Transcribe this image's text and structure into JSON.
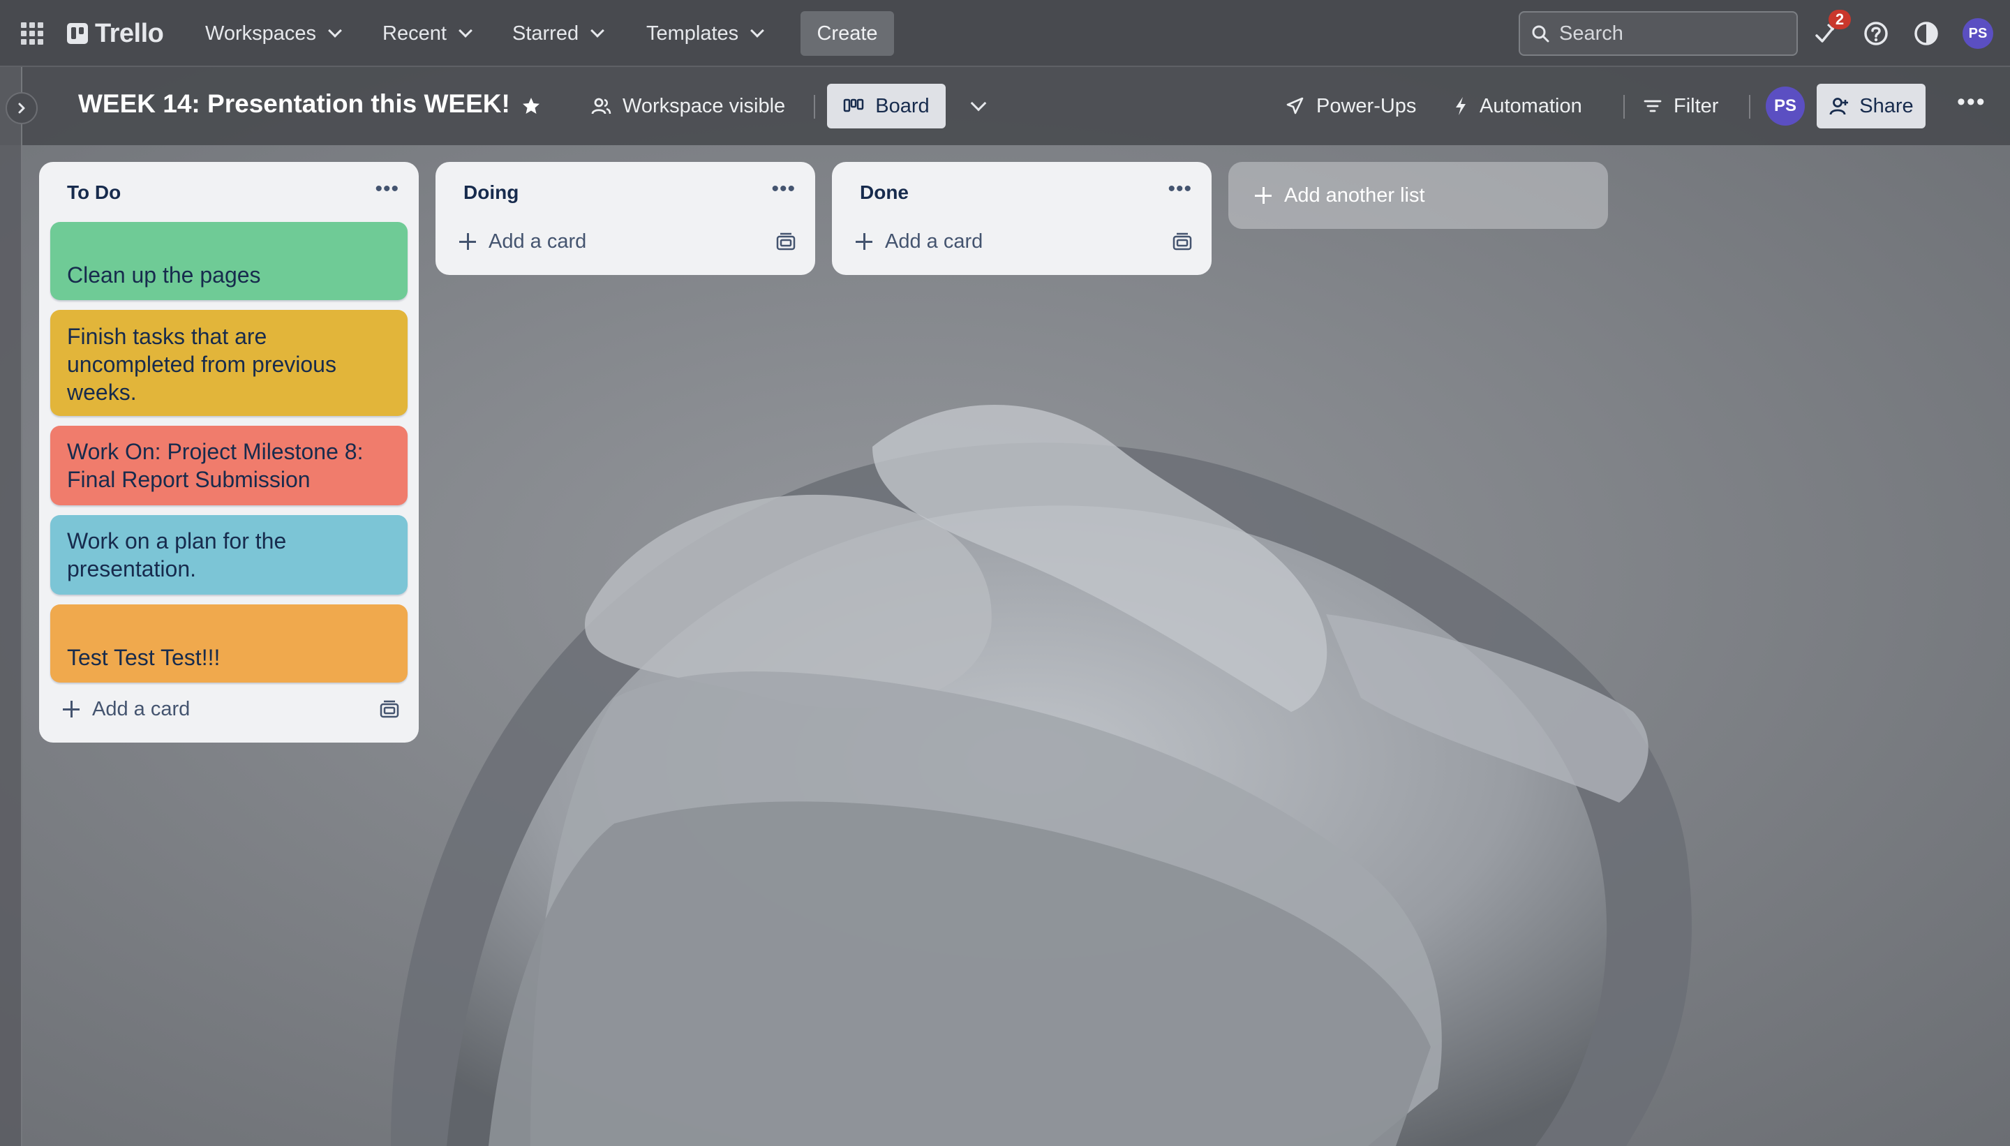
{
  "topnav": {
    "brand": "Trello",
    "menus": [
      "Workspaces",
      "Recent",
      "Starred",
      "Templates"
    ],
    "create_label": "Create",
    "search_placeholder": "Search",
    "notification_count": "2",
    "user_initials": "PS"
  },
  "board": {
    "title": "WEEK 14: Presentation this WEEK!",
    "visibility_label": "Workspace visible",
    "view_label": "Board",
    "powerups_label": "Power-Ups",
    "automation_label": "Automation",
    "filter_label": "Filter",
    "member_initials": "PS",
    "share_label": "Share"
  },
  "lists": [
    {
      "title": "To Do",
      "cards": [
        {
          "text": "Clean up the pages",
          "color": "#6fcb96"
        },
        {
          "text": "Finish tasks that are uncompleted from previous weeks.",
          "color": "#e2b53a"
        },
        {
          "text": "Work On: Project Milestone 8: Final Report Submission",
          "color": "#f07c6c"
        },
        {
          "text": "Work on a plan for the presentation.",
          "color": "#7cc5d6"
        },
        {
          "text": "Test Test Test!!!",
          "color": "#f0a94d"
        }
      ],
      "add_card_label": "Add a card"
    },
    {
      "title": "Doing",
      "cards": [],
      "add_card_label": "Add a card"
    },
    {
      "title": "Done",
      "cards": [],
      "add_card_label": "Add a card"
    }
  ],
  "add_list_label": "Add another list",
  "colors": {
    "nav_bg": "#484a4f",
    "avatar": "#5b4fc2",
    "badge": "#c9372c"
  }
}
